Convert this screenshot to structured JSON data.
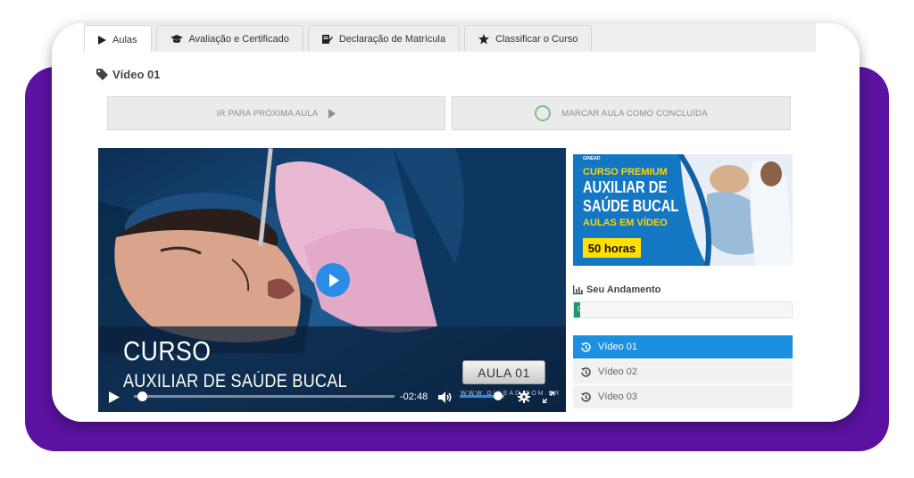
{
  "tabs": [
    {
      "label": "Aulas",
      "icon": "play-icon",
      "active": true
    },
    {
      "label": "Avaliação e Certificado",
      "icon": "graduation-cap-icon",
      "active": false
    },
    {
      "label": "Declaração de Matrícula",
      "icon": "document-edit-icon",
      "active": false
    },
    {
      "label": "Classificar o Curso",
      "icon": "star-icon",
      "active": false
    }
  ],
  "lesson": {
    "title": "Vídeo 01",
    "icon": "tag-icon"
  },
  "actions": {
    "next_label": "IR PARA PRÓXIMA AULA",
    "done_label": "MARCAR AULA COMO CONCLUÍDA"
  },
  "video": {
    "title_line1": "CURSO",
    "title_line2": "AUXILIAR DE SAÚDE BUCAL",
    "badge": "AULA 01",
    "watermark": "WWW.GINEAD.COM.BR",
    "time_remaining": "-02:48",
    "playback_progress": 0.02,
    "volume_level": 0.85
  },
  "promo": {
    "brand": "GINEAD",
    "premium": "CURSO PREMIUM",
    "line1": "AUXILIAR DE",
    "line2": "SAÚDE BUCAL",
    "aulas": "AULAS EM VÍDEO",
    "hours": "50 horas"
  },
  "progress": {
    "label": "Seu Andamento",
    "percent_text": "0%",
    "percent": 0
  },
  "lessons": [
    {
      "label": "Vídeo 01",
      "active": true
    },
    {
      "label": "Vídeo 02",
      "active": false
    },
    {
      "label": "Vídeo 03",
      "active": false
    }
  ],
  "colors": {
    "accent": "#1d8fe1",
    "purple_frame": "#5b12a0",
    "progress": "#1e9a6e",
    "promo_yellow": "#ffd400"
  }
}
